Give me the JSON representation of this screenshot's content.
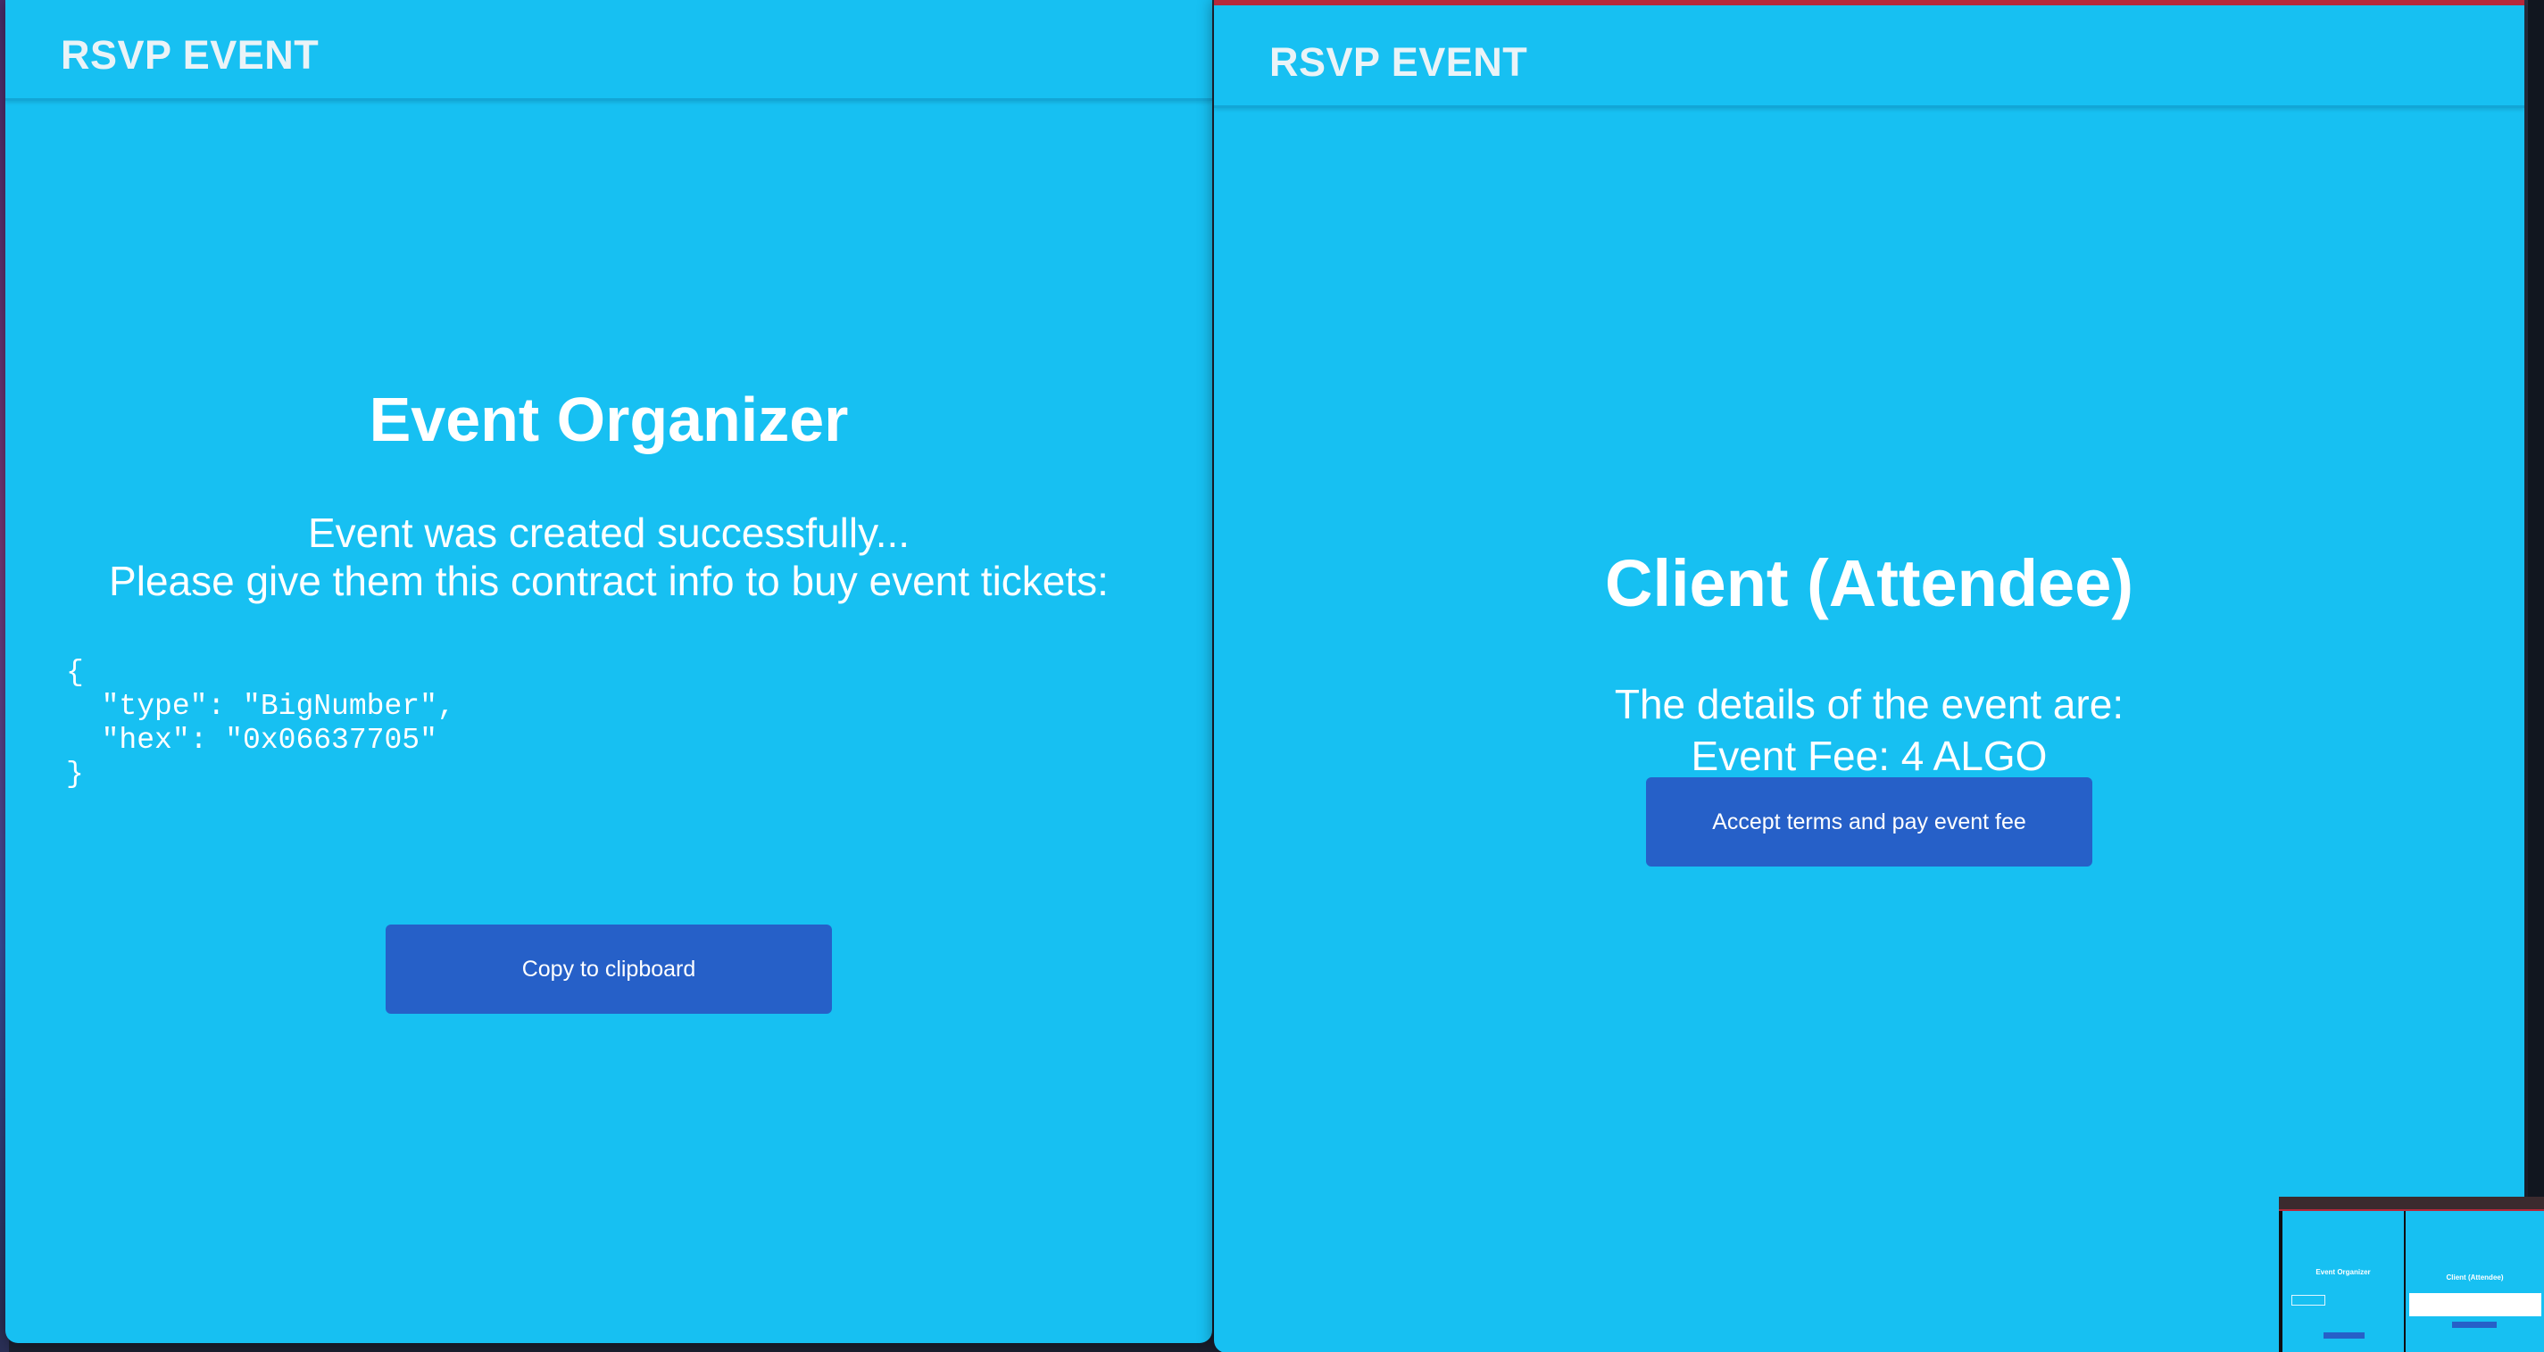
{
  "left_window": {
    "brand": "RSVP EVENT",
    "title": "Event Organizer",
    "message_line1": "Event was created successfully...",
    "message_line2": "Please give them this contract info to buy event tickets:",
    "contract_info": "{\n  \"type\": \"BigNumber\",\n  \"hex\": \"0x06637705\"\n}",
    "copy_button": "Copy to clipboard"
  },
  "right_window": {
    "brand": "RSVP EVENT",
    "title": "Client (Attendee)",
    "details_line": "The details of the event are:",
    "fee_line": "Event Fee: 4 ALGO",
    "accept_button": "Accept terms and pay event fee"
  },
  "thumbnail": {
    "left_title": "Event Organizer",
    "right_title": "Client (Attendee)"
  },
  "colors": {
    "app_background": "#17c0f2",
    "button": "#2660c8",
    "accent_bar": "#b6283a"
  }
}
